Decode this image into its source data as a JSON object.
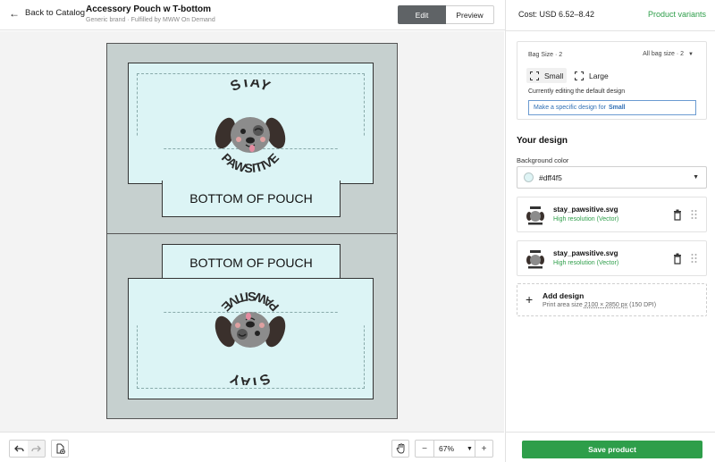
{
  "header": {
    "back_label": "Back to Catalog",
    "product_title": "Accessory Pouch w T-bottom",
    "product_subtitle": "Generic brand · Fulfilled by MWW On Demand",
    "edit_label": "Edit",
    "preview_label": "Preview"
  },
  "canvas": {
    "bottom_label_top": "BOTTOM OF POUCH",
    "bottom_label_bottom": "BOTTOM OF POUCH",
    "logo_text_top": "STAY",
    "logo_text_bottom": "PAWSITIVE",
    "background_color": "#dff4f5"
  },
  "toolbar": {
    "undo_icon": "undo-icon",
    "redo_icon": "redo-icon",
    "add_page_icon": "add-page-icon",
    "hand_icon": "hand-icon",
    "zoom_out": "−",
    "zoom_value": "67%",
    "zoom_in": "+"
  },
  "right_panel": {
    "cost": "Cost: USD 6.52–8.42",
    "product_variants": "Product variants",
    "bag_size_label": "Bag Size · 2",
    "all_bag_size_label": "All bag size · 2",
    "sizes": [
      "Small",
      "Large"
    ],
    "currently_editing": "Currently editing the default design",
    "specific_prefix": "Make a specific design for",
    "specific_size": "Small",
    "your_design": "Your design",
    "bg_color_label": "Background color",
    "bg_color_value": "#dff4f5",
    "designs": [
      {
        "file": "stay_pawsitive.svg",
        "resolution": "High resolution (Vector)"
      },
      {
        "file": "stay_pawsitive.svg",
        "resolution": "High resolution (Vector)"
      }
    ],
    "add_design": "Add design",
    "print_area_prefix": "Print area size",
    "print_area_size": "2100 × 2850 px",
    "print_area_dpi": "(150 DPI)",
    "save_label": "Save product"
  }
}
